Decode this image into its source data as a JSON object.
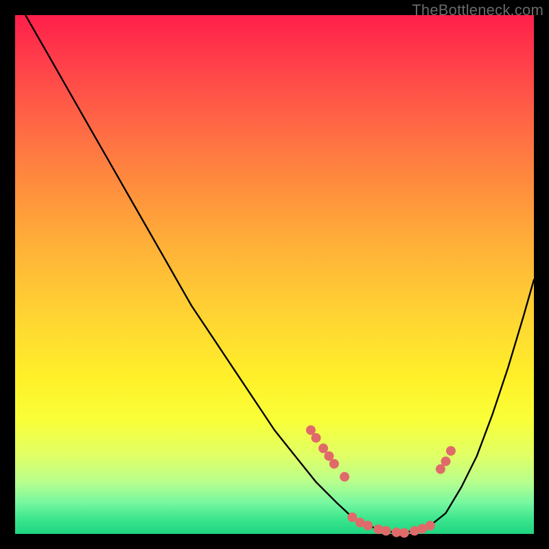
{
  "watermark": "TheBottleneck.com",
  "colors": {
    "background": "#000000",
    "gradient_top": "#ff1f4a",
    "gradient_bottom": "#1ed580",
    "curve": "#000000",
    "dots": "#e06a6a"
  },
  "chart_data": {
    "type": "line",
    "title": "",
    "xlabel": "",
    "ylabel": "",
    "xlim": [
      0,
      100
    ],
    "ylim": [
      0,
      100
    ],
    "curve": {
      "x": [
        2,
        6,
        10,
        14,
        18,
        22,
        26,
        30,
        34,
        38,
        42,
        46,
        50,
        54,
        58,
        62,
        65,
        68,
        71,
        74,
        77,
        80,
        83,
        86,
        89,
        92,
        95,
        98,
        100
      ],
      "y": [
        100,
        93,
        86,
        79,
        72,
        65,
        58,
        51,
        44,
        38,
        32,
        26,
        20,
        15,
        10,
        6,
        3.2,
        1.6,
        0.6,
        0.2,
        0.6,
        1.6,
        4,
        9,
        15,
        23,
        32,
        42,
        49
      ]
    },
    "dots": {
      "x": [
        57.0,
        58.0,
        59.4,
        60.5,
        61.5,
        63.5,
        65.0,
        66.5,
        68.0,
        70.0,
        71.5,
        73.5,
        75.0,
        77.0,
        78.5,
        80.0,
        82.0,
        83.0,
        84.0
      ],
      "y": [
        20.0,
        18.5,
        16.5,
        15.0,
        13.5,
        11.0,
        3.2,
        2.2,
        1.6,
        0.9,
        0.6,
        0.3,
        0.2,
        0.6,
        1.0,
        1.6,
        12.5,
        14.0,
        16.0
      ]
    }
  }
}
